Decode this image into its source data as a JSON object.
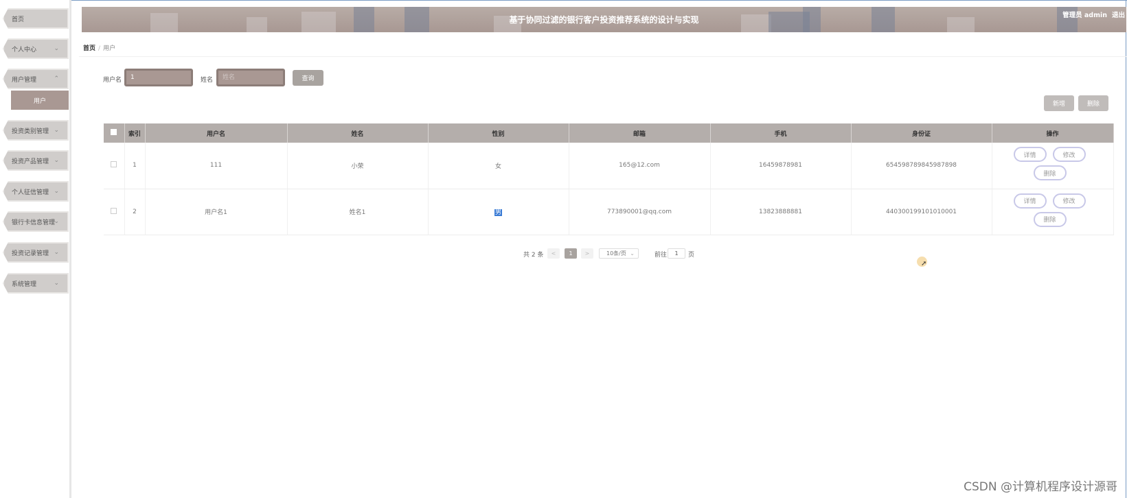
{
  "app": {
    "title": "基于协同过滤的银行客户投资推荐系统的设计与实现",
    "user": "管理员 admin",
    "logout": "退出"
  },
  "sidebar": {
    "items": [
      {
        "label": "首页"
      },
      {
        "label": "个人中心",
        "chevron": "⌄"
      },
      {
        "label": "用户管理",
        "chevron": "⌃"
      },
      {
        "label": "投资类别管理",
        "chevron": "⌄"
      },
      {
        "label": "投资产品管理",
        "chevron": "⌄"
      },
      {
        "label": "个人征信管理",
        "chevron": "⌄"
      },
      {
        "label": "银行卡信息管理",
        "chevron": "⌄"
      },
      {
        "label": "投资记录管理",
        "chevron": "⌄"
      },
      {
        "label": "系统管理",
        "chevron": "⌄"
      }
    ],
    "sub_item": "用户"
  },
  "breadcrumb": {
    "home": "首页",
    "sep": "/",
    "current": "用户"
  },
  "search": {
    "username_label": "用户名",
    "username_value": "1",
    "name_label": "姓名",
    "name_placeholder": "姓名",
    "query_button": "查询"
  },
  "actions": {
    "add": "新增",
    "delete": "删除"
  },
  "table": {
    "headers": [
      "索引",
      "用户名",
      "姓名",
      "性别",
      "邮箱",
      "手机",
      "身份证",
      "操作"
    ],
    "rows": [
      {
        "index": "1",
        "username": "111",
        "name": "小荣",
        "gender": "女",
        "email": "165@12.com",
        "phone": "16459878981",
        "idcard": "654598789845987898"
      },
      {
        "index": "2",
        "username": "用户名1",
        "name": "姓名1",
        "gender": "男",
        "email": "773890001@qq.com",
        "phone": "13823888881",
        "idcard": "440300199101010001"
      }
    ],
    "op_labels": {
      "detail": "详情",
      "edit": "修改",
      "delete": "删除"
    }
  },
  "pagination": {
    "total_text": "共 2 条",
    "prev": "<",
    "current_page": "1",
    "next": ">",
    "page_size": "10条/页",
    "goto_label": "前往",
    "goto_value": "1",
    "page_suffix": "页"
  },
  "watermark": "CSDN @计算机程序设计源哥"
}
